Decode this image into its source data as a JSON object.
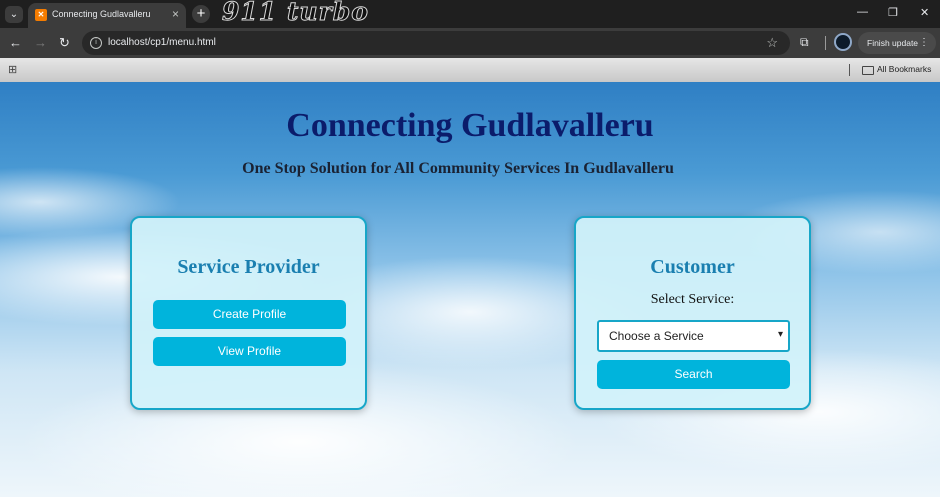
{
  "browser": {
    "tab_title": "Connecting Gudlavalleru",
    "brand_text": "911 turbo",
    "url": "localhost/cp1/menu.html",
    "update_label": "Finish update",
    "bookmarks_label": "All Bookmarks"
  },
  "page": {
    "title": "Connecting Gudlavalleru",
    "subtitle": "One Stop Solution for All Community Services In Gudlavalleru"
  },
  "provider": {
    "heading": "Service Provider",
    "create_label": "Create Profile",
    "view_label": "View Profile"
  },
  "customer": {
    "heading": "Customer",
    "select_label": "Select Service:",
    "select_value": "Choose a Service",
    "search_label": "Search"
  },
  "colors": {
    "accent": "#00b4dc",
    "card_border": "#17a6c8",
    "title": "#0b1c6b"
  }
}
